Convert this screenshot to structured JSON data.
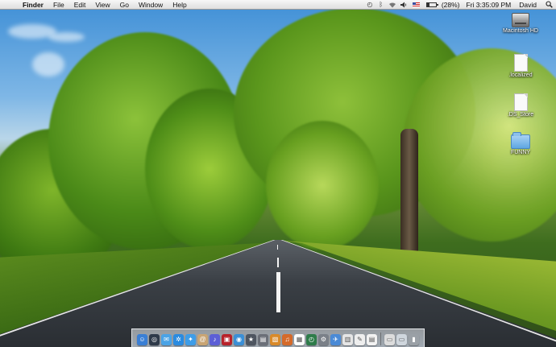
{
  "menubar": {
    "apple_glyph": "",
    "app_name": "Finder",
    "menus": [
      "File",
      "Edit",
      "View",
      "Go",
      "Window",
      "Help"
    ],
    "status": {
      "battery_text": "(28%)",
      "battery_fraction": 0.28,
      "datetime": "Fri 3:35:09 PM",
      "user": "David"
    },
    "icons": [
      "time-machine-icon",
      "bluetooth-icon",
      "wifi-icon",
      "volume-icon",
      "us-flag-icon",
      "battery-icon",
      "spotlight-icon"
    ]
  },
  "desktop": {
    "items": [
      {
        "label": "Macintosh HD",
        "icon": "hard-drive-icon"
      },
      {
        "label": ".localized",
        "icon": "document-icon"
      },
      {
        "label": ".DS_Store",
        "icon": "document-icon"
      },
      {
        "label": "FUNNY",
        "icon": "folder-icon"
      }
    ]
  },
  "dock": {
    "items": [
      {
        "icon": "finder-icon",
        "color": "#3a7fd5",
        "glyph": "☺"
      },
      {
        "icon": "dashboard-icon",
        "color": "#2e3a4a",
        "glyph": "◎"
      },
      {
        "icon": "mail-icon",
        "color": "#4aa3e6",
        "glyph": "✉"
      },
      {
        "icon": "safari-icon",
        "color": "#2a8be0",
        "glyph": "✲"
      },
      {
        "icon": "adium-icon",
        "color": "#3e9de8",
        "glyph": "✦"
      },
      {
        "icon": "contacts-icon",
        "color": "#c9a574",
        "glyph": "@"
      },
      {
        "icon": "itunes-icon",
        "color": "#5c5fd6",
        "glyph": "♪"
      },
      {
        "icon": "photo-booth-icon",
        "color": "#b8222a",
        "glyph": "▣"
      },
      {
        "icon": "iphoto-icon",
        "color": "#3b8fd6",
        "glyph": "◉"
      },
      {
        "icon": "imovie-icon",
        "color": "#4e5560",
        "glyph": "★"
      },
      {
        "icon": "clapper-icon",
        "color": "#6b6f78",
        "glyph": "▤"
      },
      {
        "icon": "image-viewer-icon",
        "color": "#d98a2a",
        "glyph": "▧"
      },
      {
        "icon": "garageband-icon",
        "color": "#d56a2a",
        "glyph": "♫"
      },
      {
        "icon": "ical-icon",
        "color": "#ffffff",
        "glyph": "▦"
      },
      {
        "icon": "time-machine-dock-icon",
        "color": "#2e7c4a",
        "glyph": "◴"
      },
      {
        "icon": "system-preferences-icon",
        "color": "#7a8088",
        "glyph": "⚙"
      },
      {
        "icon": "xcode-icon",
        "color": "#4a8ad6",
        "glyph": "✈"
      },
      {
        "icon": "preview-icon",
        "color": "#e5e5e5",
        "glyph": "▥"
      },
      {
        "icon": "textedit-icon",
        "color": "#eeeeee",
        "glyph": "✎"
      },
      {
        "icon": "documents-stack-icon",
        "color": "#f2f2f2",
        "glyph": "▤"
      },
      {
        "icon": "downloads-stack-icon",
        "color": "#dcdcdc",
        "glyph": "▭"
      },
      {
        "icon": "screen-capture-icon",
        "color": "#cfd6dd",
        "glyph": "▭"
      },
      {
        "icon": "trash-icon",
        "color": "#9aa0a6",
        "glyph": "▮"
      }
    ],
    "separator_after": 19
  }
}
